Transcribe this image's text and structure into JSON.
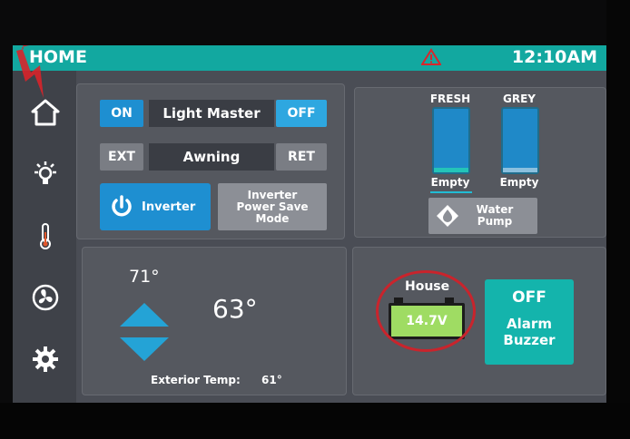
{
  "header": {
    "title": "HOME",
    "time": "12:10AM",
    "warning_icon": "warning-triangle-icon",
    "accent_color": "#12a8a0"
  },
  "sidebar": {
    "items": [
      {
        "icon": "home-icon"
      },
      {
        "icon": "lightbulb-icon"
      },
      {
        "icon": "thermometer-icon"
      },
      {
        "icon": "fan-icon"
      },
      {
        "icon": "gear-icon"
      }
    ]
  },
  "controls": {
    "light_master": {
      "on_label": "ON",
      "label": "Light Master",
      "off_label": "OFF"
    },
    "awning": {
      "ext_label": "EXT",
      "label": "Awning",
      "ret_label": "RET"
    },
    "inverter": {
      "label": "Inverter",
      "power_save_label": "Inverter Power Save Mode"
    }
  },
  "tanks": {
    "fresh": {
      "label": "FRESH",
      "status": "Empty"
    },
    "grey": {
      "label": "GREY",
      "status": "Empty"
    },
    "water_pump_label": "Water Pump"
  },
  "climate": {
    "setpoint": "71°",
    "interior": "63°",
    "exterior_label": "Exterior Temp:",
    "exterior_value": "61°"
  },
  "battery": {
    "label": "House",
    "voltage": "14.7V",
    "fill_color": "#9fdc63"
  },
  "alarm": {
    "state": "OFF",
    "label": "Alarm Buzzer"
  }
}
